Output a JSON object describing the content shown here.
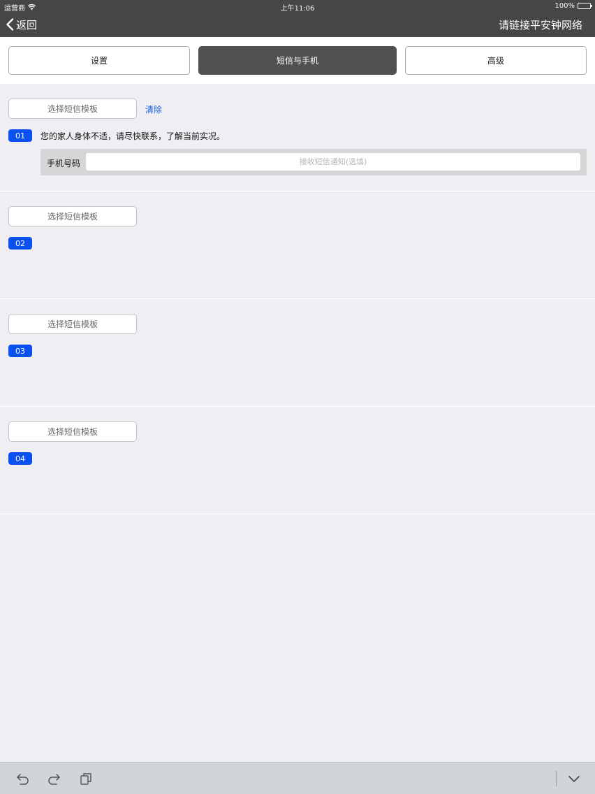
{
  "status_bar": {
    "carrier": "运营商",
    "time": "上午11:06",
    "battery": "100%"
  },
  "nav": {
    "back_label": "返回",
    "title": "请链接平安钟网络"
  },
  "tabs": [
    {
      "label": "设置",
      "active": false
    },
    {
      "label": "短信与手机",
      "active": true
    },
    {
      "label": "高级",
      "active": false
    }
  ],
  "template_button_label": "选择短信模板",
  "clear_label": "清除",
  "sections": [
    {
      "number": "01",
      "message": "您的家人身体不适，请尽快联系，了解当前实况。",
      "phone_label": "手机号码",
      "phone_placeholder": "接收短信通知(选填)",
      "phone_value": ""
    },
    {
      "number": "02"
    },
    {
      "number": "03"
    },
    {
      "number": "04"
    }
  ],
  "toolbar": {
    "icons": [
      "undo-icon",
      "redo-icon",
      "paste-icon",
      "chevron-down-icon"
    ]
  },
  "colors": {
    "bar_dark": "#464646",
    "tab_active": "#505050",
    "badge_blue": "#0b50f1",
    "link_blue": "#1a5fe0",
    "page_bg": "#efeff3"
  }
}
